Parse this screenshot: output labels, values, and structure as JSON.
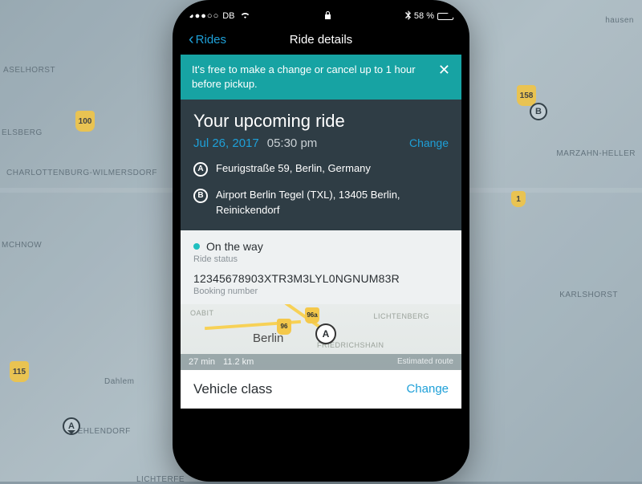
{
  "statusbar": {
    "carrier": "DB",
    "bluetooth": "✱",
    "battery_pct": "58 %"
  },
  "navbar": {
    "back_label": "Rides",
    "title": "Ride details"
  },
  "banner": {
    "message": "It's free to make a change or cancel up to 1 hour before pickup."
  },
  "ride": {
    "heading": "Your upcoming ride",
    "date": "Jul 26, 2017",
    "time": "05:30 pm",
    "change_label": "Change",
    "from": "Feurigstraße 59, Berlin, Germany",
    "to": "Airport Berlin Tegel (TXL), 13405 Berlin, Reinickendorf"
  },
  "status": {
    "text": "On the way",
    "label": "Ride status",
    "booking_number": "12345678903XTR3M3LYL0NGNUM83R",
    "booking_label": "Booking number"
  },
  "minimap": {
    "city": "Berlin",
    "shield1": "96",
    "shield2": "96a",
    "area_left": "OABIT",
    "area_right": "LICHTENBERG",
    "area_mid": "FRIEDRICHSHAIN",
    "duration": "27 min",
    "distance": "11.2 km",
    "estimated_label": "Estimated route"
  },
  "vehicle": {
    "label": "Vehicle class",
    "change_label": "Change"
  },
  "bg": {
    "l1": "CHARLOTTENBURG-WILMERSDORF",
    "l2": "elsberg",
    "l3": "aselhorst",
    "l4": "mchnow",
    "l5": "ZEHLENDORF",
    "l6": "Dahlem",
    "l7": "LICHTERFE",
    "l8": "MARZAHN-HELLER",
    "l9": "KARLSHORST",
    "l10": "hausen",
    "s100": "100",
    "s115": "115",
    "s158": "158",
    "s1": "1",
    "pinA": "A",
    "pinB": "B"
  }
}
